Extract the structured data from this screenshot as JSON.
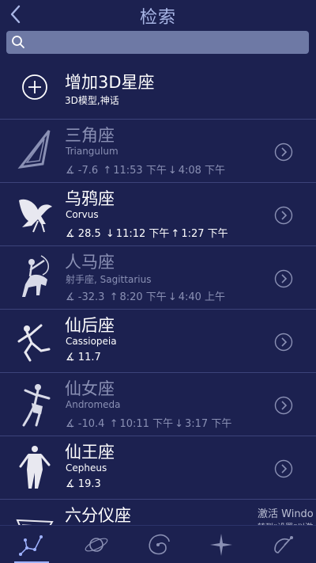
{
  "header": {
    "title": "检索",
    "back_icon": "chevron-left-icon"
  },
  "search": {
    "placeholder": "",
    "value": "",
    "icon": "search-icon"
  },
  "add_item": {
    "title": "增加3D星座",
    "subtitle": "3D模型,神话",
    "icon": "plus-circle-icon"
  },
  "constellations": [
    {
      "name": "三角座",
      "latin": "Triangulum",
      "angle": "-7.6",
      "rise": "11:53 下午",
      "set": "4:08 下午",
      "dim": true
    },
    {
      "name": "乌鸦座",
      "latin": "Corvus",
      "angle": "28.5",
      "rise": "11:12 下午",
      "set": "1:27 下午",
      "dim": false
    },
    {
      "name": "人马座",
      "latin": "射手座, Sagittarius",
      "angle": "-32.3",
      "rise": "8:20 下午",
      "set": "4:40 上午",
      "dim": true
    },
    {
      "name": "仙后座",
      "latin": "Cassiopeia",
      "angle": "11.7",
      "rise": "",
      "set": "",
      "dim": false
    },
    {
      "name": "仙女座",
      "latin": "Andromeda",
      "angle": "-10.4",
      "rise": "10:11 下午",
      "set": "3:17 下午",
      "dim": true
    },
    {
      "name": "仙王座",
      "latin": "Cepheus",
      "angle": "19.3",
      "rise": "",
      "set": "",
      "dim": false
    },
    {
      "name": "六分仪座",
      "latin": "",
      "angle": "",
      "rise": "",
      "set": "",
      "dim": false
    }
  ],
  "tabs": [
    {
      "name": "constellations",
      "icon": "constellation-icon",
      "active": true
    },
    {
      "name": "planets",
      "icon": "planet-icon",
      "active": false
    },
    {
      "name": "deep-sky",
      "icon": "galaxy-icon",
      "active": false
    },
    {
      "name": "stars",
      "icon": "star-icon",
      "active": false
    },
    {
      "name": "satellites",
      "icon": "satellite-icon",
      "active": false
    }
  ],
  "watermark": {
    "line1": "激活 Windo",
    "line2": "转到“设置”以激"
  },
  "colors": {
    "background": "#1c2150",
    "title": "#a9b6e6",
    "search_bg": "#6e79a5",
    "dim_text": "#8a90b4"
  }
}
